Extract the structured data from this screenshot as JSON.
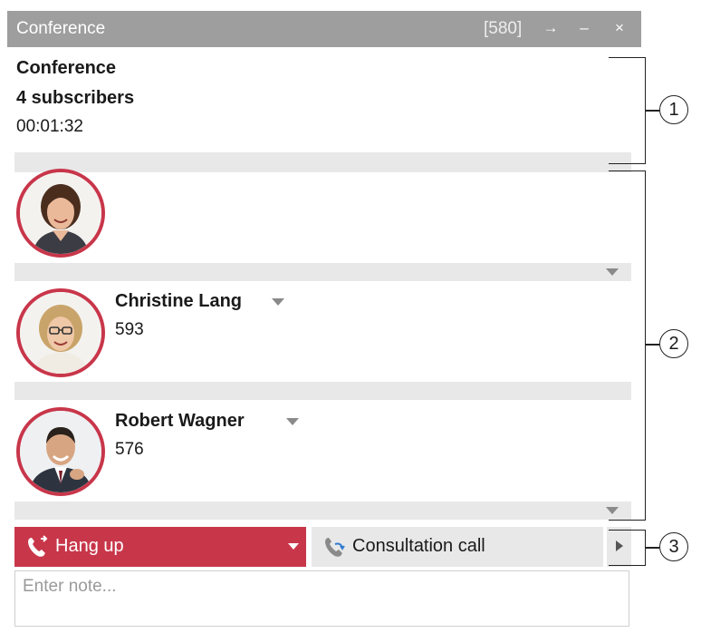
{
  "window": {
    "title": "Conference",
    "extension": "[580]",
    "pin_glyph": "→",
    "minimize_glyph": "–",
    "close_glyph": "×"
  },
  "conference": {
    "title": "Conference",
    "subscribers": "4 subscribers",
    "duration": "00:01:32"
  },
  "participants": [
    {
      "name": "",
      "number": "",
      "avatar": "woman-brown-hair"
    },
    {
      "name": "Christine Lang",
      "number": "593",
      "avatar": "woman-blonde-glasses"
    },
    {
      "name": "Robert Wagner",
      "number": "576",
      "avatar": "man-suit"
    }
  ],
  "actions": {
    "hang_up": "Hang up",
    "consultation": "Consultation call"
  },
  "note": {
    "placeholder": "Enter note..."
  },
  "callouts": [
    "1",
    "2",
    "3"
  ],
  "colors": {
    "accent": "#c8364a",
    "titlebar": "#9e9e9e",
    "separator": "#e8e8e8"
  },
  "icons": [
    "pin-icon",
    "minimize-icon",
    "close-icon",
    "handset-icon",
    "consult-handset-icon",
    "expand-arrow-icon",
    "dropdown-caret-icon"
  ]
}
